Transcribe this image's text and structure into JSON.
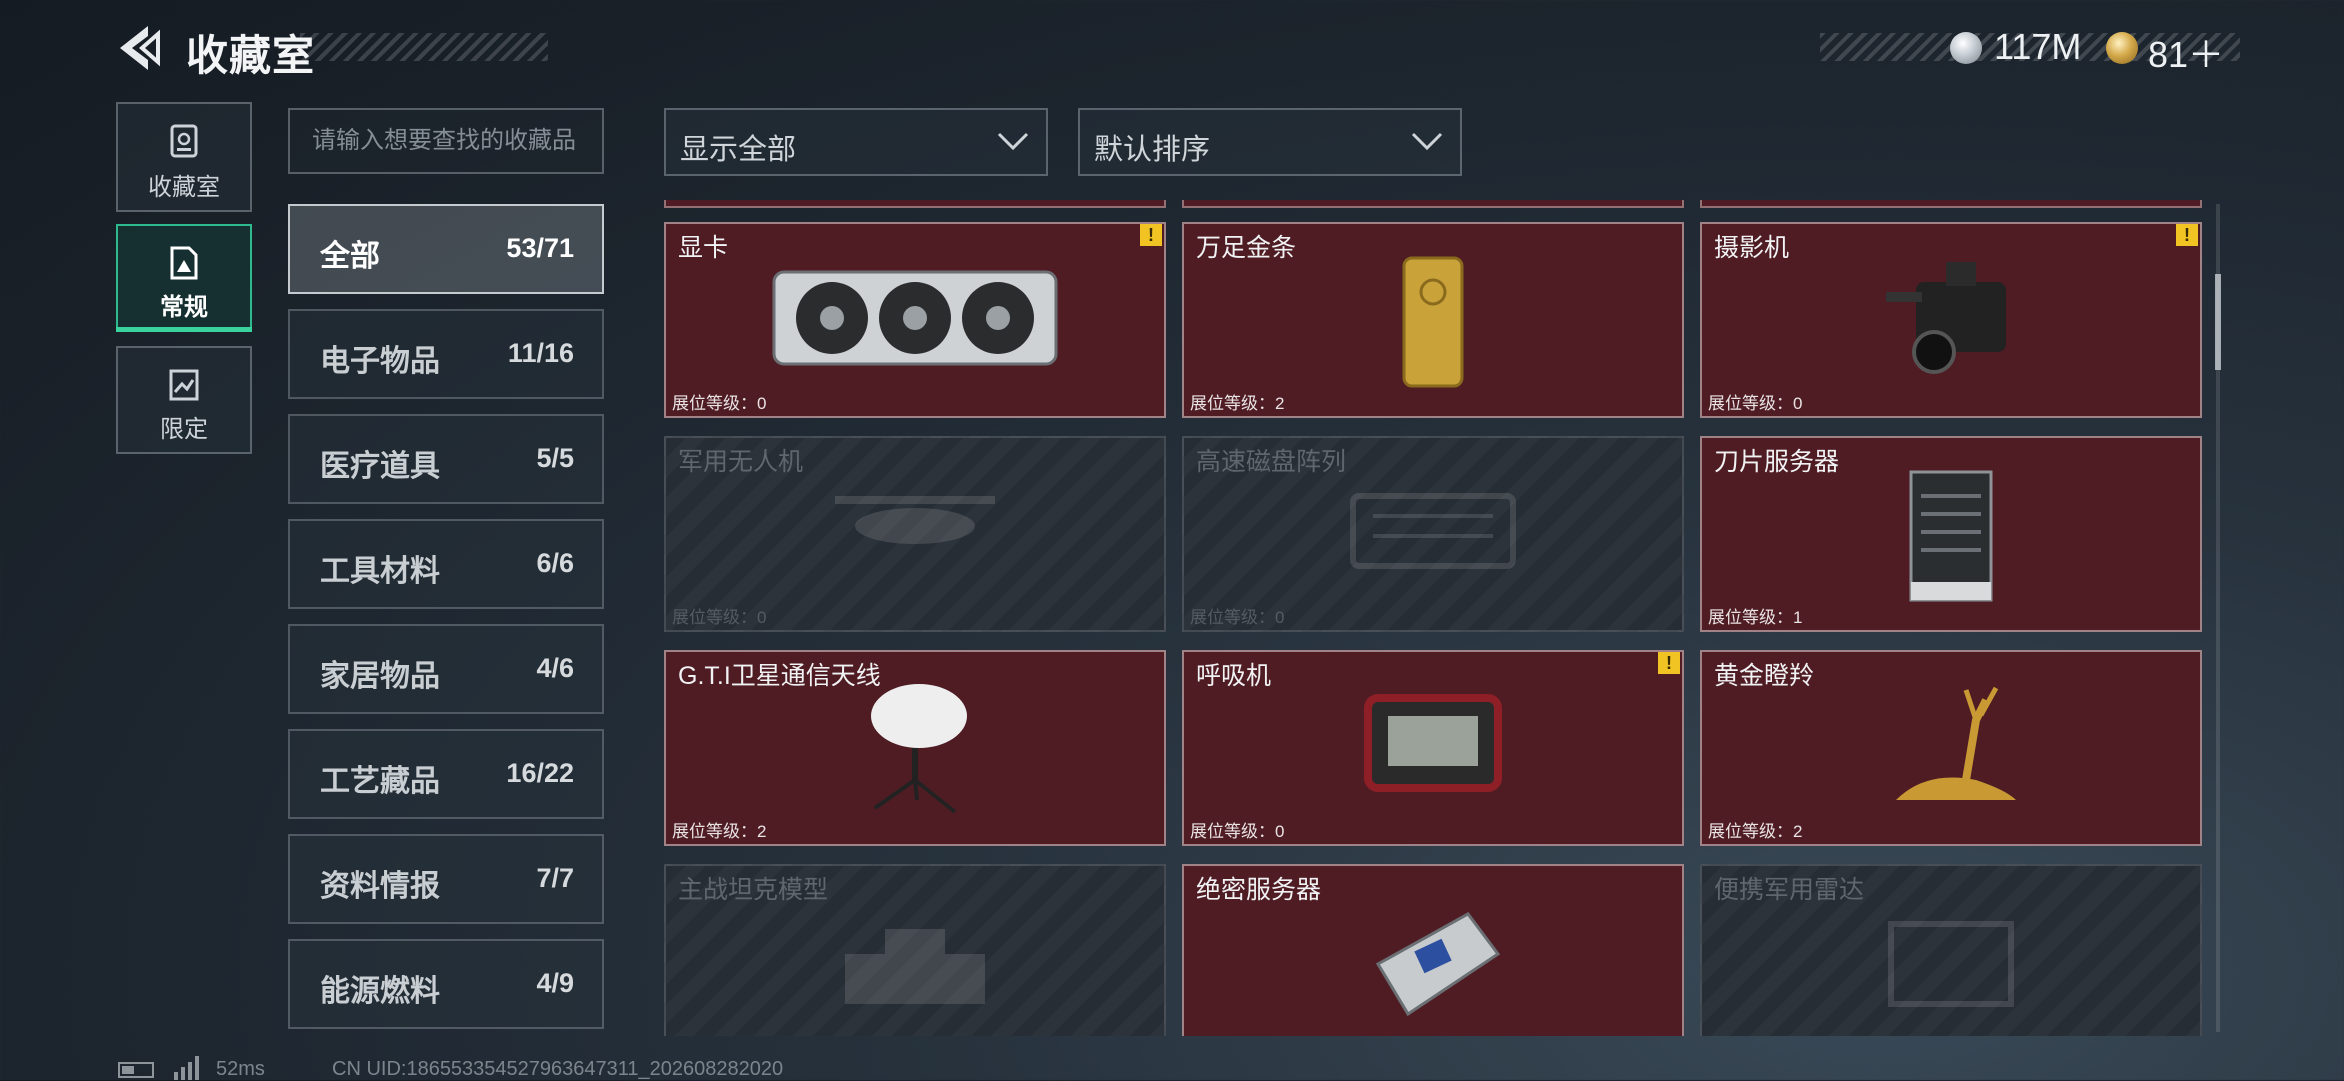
{
  "header": {
    "title": "收藏室",
    "currency_1": "117M",
    "currency_2": "81＋",
    "currency_1_icon": "silver-coin-icon",
    "currency_2_icon": "gold-coin-icon"
  },
  "nav": [
    {
      "label": "收藏室",
      "icon": "collection-room-icon"
    },
    {
      "label": "常规",
      "icon": "normal-category-icon",
      "active": true
    },
    {
      "label": "限定",
      "icon": "limited-category-icon"
    }
  ],
  "search": {
    "placeholder": "请输入想要查找的收藏品"
  },
  "categories": [
    {
      "label": "全部",
      "count": "53/71",
      "active": true
    },
    {
      "label": "电子物品",
      "count": "11/16"
    },
    {
      "label": "医疗道具",
      "count": "5/5"
    },
    {
      "label": "工具材料",
      "count": "6/6"
    },
    {
      "label": "家居物品",
      "count": "4/6"
    },
    {
      "label": "工艺藏品",
      "count": "16/22"
    },
    {
      "label": "资料情报",
      "count": "7/7"
    },
    {
      "label": "能源燃料",
      "count": "4/9"
    }
  ],
  "filters": {
    "display": "显示全部",
    "sort": "默认排序"
  },
  "items": [
    {
      "name": "显卡",
      "level": "展位等级：0",
      "unlocked": true,
      "warning": true,
      "icon": "graphics-card-icon"
    },
    {
      "name": "万足金条",
      "level": "展位等级：2",
      "unlocked": true,
      "warning": false,
      "icon": "gold-bar-icon"
    },
    {
      "name": "摄影机",
      "level": "展位等级：0",
      "unlocked": true,
      "warning": true,
      "icon": "camera-icon"
    },
    {
      "name": "军用无人机",
      "level": "展位等级：0",
      "unlocked": false,
      "warning": false,
      "icon": "drone-icon"
    },
    {
      "name": "高速磁盘阵列",
      "level": "展位等级：0",
      "unlocked": false,
      "warning": false,
      "icon": "disk-array-icon"
    },
    {
      "name": "刀片服务器",
      "level": "展位等级：1",
      "unlocked": true,
      "warning": false,
      "icon": "blade-server-icon"
    },
    {
      "name": "G.T.I卫星通信天线",
      "level": "展位等级：2",
      "unlocked": true,
      "warning": false,
      "icon": "satellite-antenna-icon"
    },
    {
      "name": "呼吸机",
      "level": "展位等级：0",
      "unlocked": true,
      "warning": true,
      "icon": "ventilator-icon"
    },
    {
      "name": "黄金瞪羚",
      "level": "展位等级：2",
      "unlocked": true,
      "warning": false,
      "icon": "golden-gazelle-icon"
    },
    {
      "name": "主战坦克模型",
      "level": "",
      "unlocked": false,
      "warning": false,
      "icon": "tank-model-icon"
    },
    {
      "name": "绝密服务器",
      "level": "",
      "unlocked": true,
      "warning": false,
      "icon": "secret-server-icon"
    },
    {
      "name": "便携军用雷达",
      "level": "",
      "unlocked": false,
      "warning": false,
      "icon": "radar-icon"
    }
  ],
  "footer": {
    "ping": "52ms",
    "uid": "CN UID:18655335452796364731​1_202608282020"
  },
  "colors": {
    "accent": "#3ad39e",
    "card_unlocked": "#4f1c24",
    "warning": "#f1c423"
  }
}
